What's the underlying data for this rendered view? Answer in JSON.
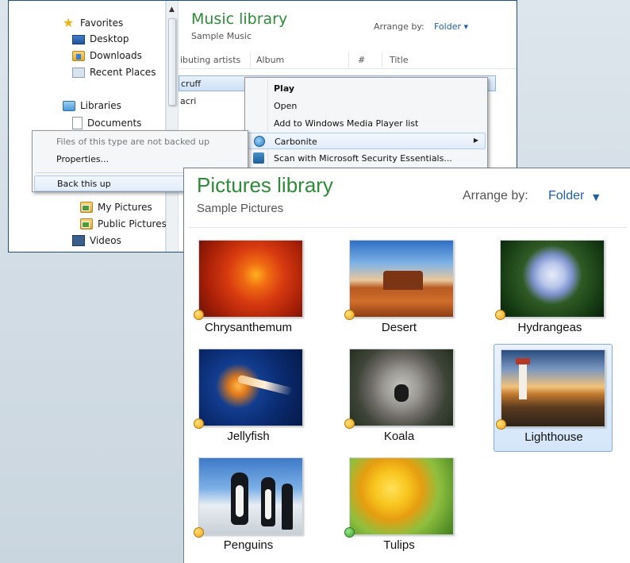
{
  "music_window": {
    "nav": {
      "favorites": "Favorites",
      "desktop": "Desktop",
      "downloads": "Downloads",
      "recent_places": "Recent Places",
      "libraries": "Libraries",
      "documents": "Documents",
      "my_pictures": "My Pictures",
      "public_pictures": "Public Pictures",
      "videos": "Videos"
    },
    "title": "Music library",
    "subtitle": "Sample Music",
    "arrange_label": "Arrange by:",
    "arrange_value": "Folder",
    "columns": [
      "ibuting artists",
      "Album",
      "#",
      "Title"
    ],
    "rows": [
      "cruff",
      "acri"
    ],
    "context_menu": {
      "play": "Play",
      "open": "Open",
      "add_wmp": "Add to Windows Media Player list",
      "carbonite": "Carbonite",
      "scan": "Scan with Microsoft Security Essentials..."
    },
    "carbonite_menu": {
      "header": "Files of this type are not backed up",
      "properties": "Properties...",
      "back_up": "Back this up"
    }
  },
  "pictures_window": {
    "title": "Pictures library",
    "subtitle": "Sample Pictures",
    "arrange_label": "Arrange by:",
    "arrange_value": "Folder",
    "items": [
      {
        "name": "Chrysanthemum",
        "status": "pending"
      },
      {
        "name": "Desert",
        "status": "pending"
      },
      {
        "name": "Hydrangeas",
        "status": "pending"
      },
      {
        "name": "Jellyfish",
        "status": "pending"
      },
      {
        "name": "Koala",
        "status": "pending"
      },
      {
        "name": "Lighthouse",
        "status": "pending",
        "selected": true
      },
      {
        "name": "Penguins",
        "status": "pending"
      },
      {
        "name": "Tulips",
        "status": "backed-up"
      }
    ]
  },
  "colors": {
    "library_title": "#2e8b3a",
    "link_blue": "#1e5fa8",
    "status_pending": "#f0a11a",
    "status_backed_up": "#37a52c"
  }
}
